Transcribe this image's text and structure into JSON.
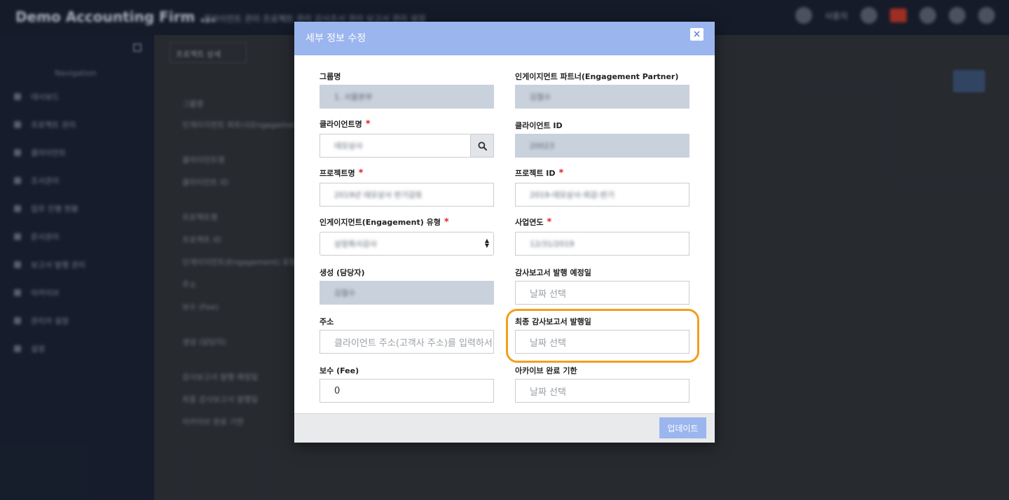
{
  "app": {
    "brand": "Demo Accounting Firm ...",
    "topnav": "클라이언트 관리   프로젝트 관리   감사조서 관리   보고서 관리   설정",
    "top_right_text": "사용자",
    "sidebar_title": "Navigation",
    "sidebar_items": [
      "대시보드",
      "프로젝트 관리",
      "클라이언트",
      "조서관리",
      "업무 진행 현황",
      "문서관리",
      "보고서 발행 관리",
      "아카이브",
      "관리자 설정",
      "설정"
    ],
    "tab_chip": "프로젝트 상세",
    "bg_lines": [
      "그룹명",
      "인게이지먼트 파트너(Engagement Partner)",
      "클라이언트명",
      "클라이언트 ID",
      "프로젝트명",
      "프로젝트 ID",
      "인게이지먼트(Engagement) 유형",
      "주소",
      "보수 (Fee)",
      "생성 (담당자)",
      "감사보고서 발행 예정일",
      "최종 감사보고서 발행일",
      "아카이브 완료 기한"
    ]
  },
  "modal": {
    "title": "세부 정보 수정",
    "close_label": "×",
    "update_label": "업데이트",
    "fields": {
      "group_name": {
        "label": "그룹명",
        "value": "1. 서울본부"
      },
      "engagement_partner": {
        "label": "인게이지먼트 파트너(Engagement Partner)",
        "value": "김철수"
      },
      "client_name": {
        "label": "클라이언트명",
        "value": "데모상사"
      },
      "client_id": {
        "label": "클라이언트 ID",
        "value": "20023"
      },
      "project_name": {
        "label": "프로젝트명",
        "value": "2019년 데모상사 반기감토"
      },
      "project_id": {
        "label": "프로젝트 ID",
        "value": "2019-데모상사-외감-반기"
      },
      "engagement_type": {
        "label": "인게이지먼트(Engagement) 유형",
        "value": "상장회사감사"
      },
      "fiscal_year": {
        "label": "사업연도",
        "value": "12/31/2019"
      },
      "creator": {
        "label": "생성 (담당자)",
        "value": "김철수"
      },
      "planned_report_date": {
        "label": "감사보고서 발행 예정일",
        "placeholder": "날짜 선택"
      },
      "address": {
        "label": "주소",
        "placeholder": "클라이언트 주소(고객사 주소)를 입력하서"
      },
      "final_report_date": {
        "label": "최종 감사보고서 발행일",
        "placeholder": "날짜 선택"
      },
      "fee": {
        "label": "보수 (Fee)",
        "value": "0"
      },
      "archive_deadline": {
        "label": "아카이브 완료 기한",
        "placeholder": "날짜 선택"
      }
    },
    "required_mark": "*"
  },
  "colors": {
    "header": "#9bb5ee",
    "readonly_bg": "#c9d1dc",
    "highlight": "#f0a01e",
    "required": "#e02424"
  }
}
